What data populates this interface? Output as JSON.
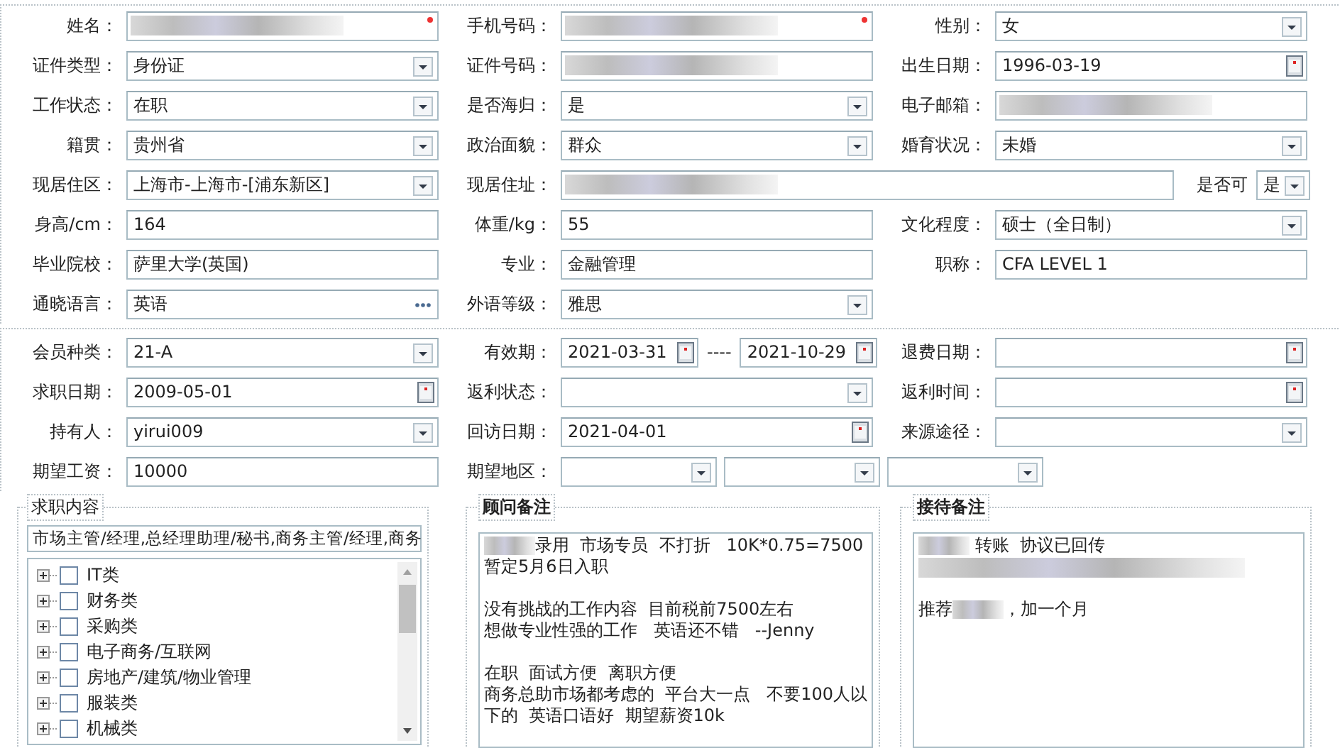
{
  "sections": [
    {
      "rows": [
        [
          {
            "label": "姓名：",
            "kind": "redacted",
            "required": true
          },
          {
            "label": "手机号码：",
            "kind": "redacted",
            "required": true
          },
          {
            "label": "性别：",
            "kind": "select",
            "value": "女"
          }
        ],
        [
          {
            "label": "证件类型：",
            "kind": "select",
            "value": "身份证"
          },
          {
            "label": "证件号码：",
            "kind": "redacted"
          },
          {
            "label": "出生日期：",
            "kind": "date",
            "value": "1996-03-19"
          }
        ],
        [
          {
            "label": "工作状态：",
            "kind": "select",
            "value": "在职"
          },
          {
            "label": "是否海归：",
            "kind": "select",
            "value": "是"
          },
          {
            "label": "电子邮箱：",
            "kind": "redacted"
          }
        ],
        [
          {
            "label": "籍贯：",
            "kind": "select",
            "value": "贵州省"
          },
          {
            "label": "政治面貌：",
            "kind": "select",
            "value": "群众"
          },
          {
            "label": "婚育状况：",
            "kind": "select",
            "value": "未婚"
          }
        ],
        [
          {
            "label": "现居住区：",
            "kind": "select",
            "value": "上海市-上海市-[浦东新区]"
          },
          {
            "label": "现居住址：",
            "kind": "redacted"
          },
          {
            "label": "是否可",
            "kind": "compact-select",
            "value": "是"
          }
        ],
        [
          {
            "label": "身高/cm：",
            "kind": "text",
            "value": "164"
          },
          {
            "label": "体重/kg：",
            "kind": "text",
            "value": "55"
          },
          {
            "label": "文化程度：",
            "kind": "select",
            "value": "硕士（全日制）"
          }
        ],
        [
          {
            "label": "毕业院校：",
            "kind": "text",
            "value": "萨里大学(英国)"
          },
          {
            "label": "专业：",
            "kind": "text",
            "value": "金融管理"
          },
          {
            "label": "职称：",
            "kind": "text",
            "value": "CFA LEVEL 1"
          }
        ],
        [
          {
            "label": "通晓语言：",
            "kind": "more",
            "value": "英语"
          },
          {
            "label": "外语等级：",
            "kind": "select",
            "value": "雅思"
          }
        ]
      ]
    },
    {
      "rows": [
        [
          {
            "label": "会员种类：",
            "kind": "select",
            "value": "21-A"
          },
          {
            "label": "有效期：",
            "kind": "date-range",
            "from": "2021-03-31",
            "separator": "----",
            "to": "2021-10-29"
          },
          {
            "label": "退费日期：",
            "kind": "date"
          }
        ],
        [
          {
            "label": "求职日期：",
            "kind": "date",
            "value": "2009-05-01"
          },
          {
            "label": "返利状态：",
            "kind": "select"
          },
          {
            "label": "返利时间：",
            "kind": "date"
          }
        ],
        [
          {
            "label": "持有人：",
            "kind": "select",
            "value": "yirui009"
          },
          {
            "label": "回访日期：",
            "kind": "date",
            "value": "2021-04-01"
          },
          {
            "label": "来源途径：",
            "kind": "select"
          }
        ],
        [
          {
            "label": "期望工资：",
            "kind": "text",
            "value": "10000"
          },
          {
            "label": "期望地区：",
            "kind": "region",
            "selects": [
              {
                "kind": "select"
              },
              {
                "kind": "select"
              },
              {
                "kind": "select"
              }
            ]
          }
        ]
      ]
    }
  ],
  "panels": [
    {
      "kind": "tree",
      "title": "求职内容",
      "summary": "市场主管/经理,总经理助理/秘书,商务主管/经理,商务",
      "items": [
        {
          "label": "IT类",
          "checked": false,
          "expanded": false
        },
        {
          "label": "财务类",
          "checked": false,
          "expanded": false
        },
        {
          "label": "采购类",
          "checked": false,
          "expanded": false
        },
        {
          "label": "电子商务/互联网",
          "checked": false,
          "expanded": false
        },
        {
          "label": "房地产/建筑/物业管理",
          "checked": false,
          "expanded": false
        },
        {
          "label": "服装类",
          "checked": false,
          "expanded": false
        },
        {
          "label": "机械类",
          "checked": false,
          "expanded": false
        }
      ]
    },
    {
      "kind": "notes",
      "title": "顾问备注",
      "paragraphs": [
        {
          "lines": [
            {
              "parts": [
                {
                  "kind": "redacted"
                },
                {
                  "kind": "text",
                  "text": "录用  市场专员  不打折   10K*0.75=7500"
                }
              ]
            },
            {
              "parts": [
                {
                  "kind": "text",
                  "text": "暂定5月6日入职"
                }
              ]
            }
          ]
        },
        {
          "lines": [
            {
              "parts": [
                {
                  "kind": "text",
                  "text": "没有挑战的工作内容  目前税前7500左右"
                }
              ]
            },
            {
              "parts": [
                {
                  "kind": "text",
                  "text": "想做专业性强的工作   英语还不错   --Jenny"
                }
              ]
            }
          ]
        },
        {
          "lines": [
            {
              "parts": [
                {
                  "kind": "text",
                  "text": "在职  面试方便  离职方便"
                }
              ]
            },
            {
              "parts": [
                {
                  "kind": "text",
                  "text": "商务总助市场都考虑的  平台大一点   不要100人以下的  英语口语好  期望薪资10k"
                }
              ]
            }
          ]
        }
      ]
    },
    {
      "kind": "notes",
      "title": "接待备注",
      "paragraphs": [
        {
          "lines": [
            {
              "parts": [
                {
                  "kind": "redacted"
                },
                {
                  "kind": "text",
                  "text": " 转账  协议已回传"
                }
              ]
            },
            {
              "parts": [
                {
                  "kind": "redacted-line"
                }
              ]
            }
          ]
        },
        {
          "lines": [
            {
              "parts": [
                {
                  "kind": "text",
                  "text": "推荐"
                },
                {
                  "kind": "redacted"
                },
                {
                  "kind": "text",
                  "text": "，加一个月"
                }
              ]
            }
          ]
        }
      ]
    }
  ]
}
